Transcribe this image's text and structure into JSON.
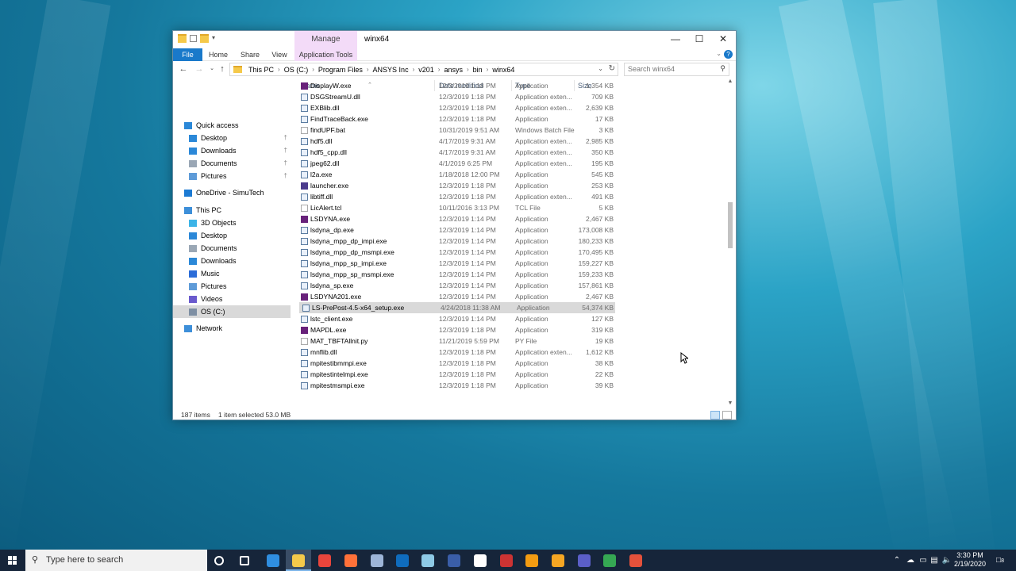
{
  "window": {
    "title": "winx64",
    "manage_tab": "Manage",
    "controls": {
      "minimize": "—",
      "maximize": "☐",
      "close": "✕"
    }
  },
  "ribbon": {
    "tabs": [
      "File",
      "Home",
      "Share",
      "View",
      "Application Tools"
    ],
    "help": "?"
  },
  "address": {
    "crumbs": [
      "This PC",
      "OS (C:)",
      "Program Files",
      "ANSYS Inc",
      "v201",
      "ansys",
      "bin",
      "winx64"
    ],
    "search_placeholder": "Search winx64"
  },
  "nav": {
    "items": [
      {
        "label": "Quick access",
        "icon": "star-icon"
      },
      {
        "label": "Desktop",
        "icon": "desktop-icon",
        "pinned": true
      },
      {
        "label": "Downloads",
        "icon": "download-icon",
        "pinned": true
      },
      {
        "label": "Documents",
        "icon": "documents-icon",
        "pinned": true
      },
      {
        "label": "Pictures",
        "icon": "pictures-icon",
        "pinned": true
      },
      {
        "label": "OneDrive - SimuTech",
        "icon": "cloud-icon"
      },
      {
        "label": "This PC",
        "icon": "computer-icon"
      },
      {
        "label": "3D Objects",
        "icon": "cube-icon"
      },
      {
        "label": "Desktop",
        "icon": "desktop-icon"
      },
      {
        "label": "Documents",
        "icon": "documents-icon"
      },
      {
        "label": "Downloads",
        "icon": "download-icon"
      },
      {
        "label": "Music",
        "icon": "music-icon"
      },
      {
        "label": "Pictures",
        "icon": "pictures-icon"
      },
      {
        "label": "Videos",
        "icon": "videos-icon"
      },
      {
        "label": "OS (C:)",
        "icon": "drive-icon",
        "selected": true
      },
      {
        "label": "Network",
        "icon": "network-icon"
      }
    ]
  },
  "columns": {
    "name": "Name",
    "date": "Date modified",
    "type": "Type",
    "size": "Size"
  },
  "files": [
    {
      "name": "DisplayW.exe",
      "date": "12/3/2019 1:18 PM",
      "type": "Application",
      "size": "1,354 KB",
      "icon": "vs"
    },
    {
      "name": "DSGStreamU.dll",
      "date": "12/3/2019 1:18 PM",
      "type": "Application exten...",
      "size": "709 KB",
      "icon": "dll"
    },
    {
      "name": "EXBlib.dll",
      "date": "12/3/2019 1:18 PM",
      "type": "Application exten...",
      "size": "2,639 KB",
      "icon": "dll"
    },
    {
      "name": "FindTraceBack.exe",
      "date": "12/3/2019 1:18 PM",
      "type": "Application",
      "size": "17 KB",
      "icon": "exe"
    },
    {
      "name": "findUPF.bat",
      "date": "10/31/2019 9:51 AM",
      "type": "Windows Batch File",
      "size": "3 KB",
      "icon": "doc"
    },
    {
      "name": "hdf5.dll",
      "date": "4/17/2019 9:31 AM",
      "type": "Application exten...",
      "size": "2,985 KB",
      "icon": "dll"
    },
    {
      "name": "hdf5_cpp.dll",
      "date": "4/17/2019 9:31 AM",
      "type": "Application exten...",
      "size": "350 KB",
      "icon": "dll"
    },
    {
      "name": "jpeg62.dll",
      "date": "4/1/2019 6:25 PM",
      "type": "Application exten...",
      "size": "195 KB",
      "icon": "dll"
    },
    {
      "name": "l2a.exe",
      "date": "1/18/2018 12:00 PM",
      "type": "Application",
      "size": "545 KB",
      "icon": "exe"
    },
    {
      "name": "launcher.exe",
      "date": "12/3/2019 1:18 PM",
      "type": "Application",
      "size": "253 KB",
      "icon": "lnc"
    },
    {
      "name": "libtiff.dll",
      "date": "12/3/2019 1:18 PM",
      "type": "Application exten...",
      "size": "491 KB",
      "icon": "dll"
    },
    {
      "name": "LicAlert.tcl",
      "date": "10/11/2016 3:13 PM",
      "type": "TCL File",
      "size": "5 KB",
      "icon": "doc"
    },
    {
      "name": "LSDYNA.exe",
      "date": "12/3/2019 1:14 PM",
      "type": "Application",
      "size": "2,467 KB",
      "icon": "vs"
    },
    {
      "name": "lsdyna_dp.exe",
      "date": "12/3/2019 1:14 PM",
      "type": "Application",
      "size": "173,008 KB",
      "icon": "exe"
    },
    {
      "name": "lsdyna_mpp_dp_impi.exe",
      "date": "12/3/2019 1:14 PM",
      "type": "Application",
      "size": "180,233 KB",
      "icon": "exe"
    },
    {
      "name": "lsdyna_mpp_dp_msmpi.exe",
      "date": "12/3/2019 1:14 PM",
      "type": "Application",
      "size": "170,495 KB",
      "icon": "exe"
    },
    {
      "name": "lsdyna_mpp_sp_impi.exe",
      "date": "12/3/2019 1:14 PM",
      "type": "Application",
      "size": "159,227 KB",
      "icon": "exe"
    },
    {
      "name": "lsdyna_mpp_sp_msmpi.exe",
      "date": "12/3/2019 1:14 PM",
      "type": "Application",
      "size": "159,233 KB",
      "icon": "exe"
    },
    {
      "name": "lsdyna_sp.exe",
      "date": "12/3/2019 1:14 PM",
      "type": "Application",
      "size": "157,861 KB",
      "icon": "exe"
    },
    {
      "name": "LSDYNA201.exe",
      "date": "12/3/2019 1:14 PM",
      "type": "Application",
      "size": "2,467 KB",
      "icon": "vs"
    },
    {
      "name": "LS-PrePost-4.5-x64_setup.exe",
      "date": "4/24/2018 11:38 AM",
      "type": "Application",
      "size": "54,374 KB",
      "icon": "exe",
      "selected": true
    },
    {
      "name": "lstc_client.exe",
      "date": "12/3/2019 1:14 PM",
      "type": "Application",
      "size": "127 KB",
      "icon": "exe"
    },
    {
      "name": "MAPDL.exe",
      "date": "12/3/2019 1:18 PM",
      "type": "Application",
      "size": "319 KB",
      "icon": "vs"
    },
    {
      "name": "MAT_TBFTAllnit.py",
      "date": "11/21/2019 5:59 PM",
      "type": "PY File",
      "size": "19 KB",
      "icon": "doc"
    },
    {
      "name": "mnflib.dll",
      "date": "12/3/2019 1:18 PM",
      "type": "Application exten...",
      "size": "1,612 KB",
      "icon": "dll"
    },
    {
      "name": "mpitestibmmpi.exe",
      "date": "12/3/2019 1:18 PM",
      "type": "Application",
      "size": "38 KB",
      "icon": "exe"
    },
    {
      "name": "mpitestintelmpi.exe",
      "date": "12/3/2019 1:18 PM",
      "type": "Application",
      "size": "22 KB",
      "icon": "exe"
    },
    {
      "name": "mpitestmsmpi.exe",
      "date": "12/3/2019 1:18 PM",
      "type": "Application",
      "size": "39 KB",
      "icon": "exe"
    }
  ],
  "status": {
    "count": "187 items",
    "selection": "1 item selected  53.0 MB"
  },
  "taskbar": {
    "search_placeholder": "Type here to search",
    "time": "3:30 PM",
    "date": "2/19/2020",
    "notifications": "8",
    "apps": [
      {
        "name": "cortana-icon",
        "color": "#ffffff"
      },
      {
        "name": "task-view-icon",
        "color": "#ffffff"
      },
      {
        "name": "edge-icon",
        "color": "#2f8ee0"
      },
      {
        "name": "file-explorer-icon",
        "color": "#f5c94a"
      },
      {
        "name": "chrome-icon",
        "color": "#e8453c"
      },
      {
        "name": "firefox-icon",
        "color": "#ff7139"
      },
      {
        "name": "app-icon",
        "color": "#9db5d8"
      },
      {
        "name": "outlook-icon",
        "color": "#0f6cbd"
      },
      {
        "name": "notepad-icon",
        "color": "#8ecae6"
      },
      {
        "name": "ansys-icon",
        "color": "#3a5ea8"
      },
      {
        "name": "remote-icon",
        "color": "#ffffff"
      },
      {
        "name": "tools-icon",
        "color": "#c33"
      },
      {
        "name": "phone-icon",
        "color": "#f39c12"
      },
      {
        "name": "messenger-icon",
        "color": "#f5a623"
      },
      {
        "name": "teams-icon",
        "color": "#5b5fc7"
      },
      {
        "name": "camtasia-green-icon",
        "color": "#35a853"
      },
      {
        "name": "camtasia-red-icon",
        "color": "#e4513b"
      }
    ]
  }
}
